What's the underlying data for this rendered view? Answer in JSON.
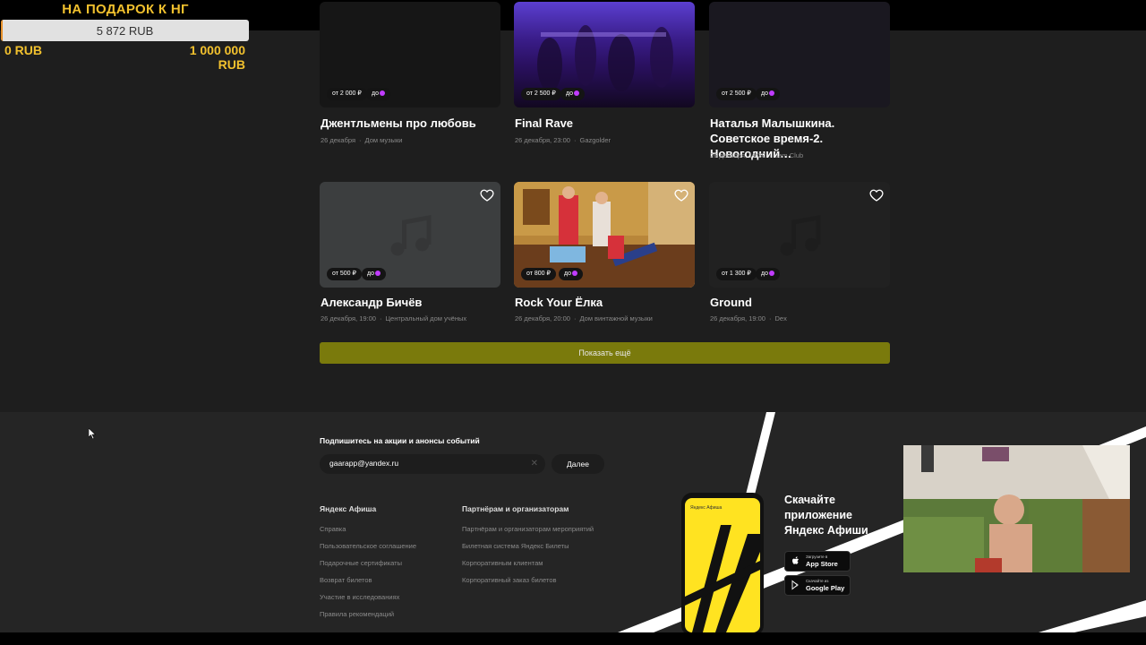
{
  "donation_goal": {
    "title": "НА ПОДАРОК К НГ",
    "current": "5 872 RUB",
    "min": "0 RUB",
    "max": "1 000 000 RUB",
    "progress_fraction": 0.005872,
    "colors": {
      "accent": "#f2c12e",
      "fill": "#e7912b",
      "track": "#e1e1e1"
    }
  },
  "events": [
    {
      "name": "Джентльмены про любовь",
      "date": "26 декабря",
      "venue": "Дом музыки",
      "price": "от 2 000 ₽",
      "until": "до",
      "image": "dark"
    },
    {
      "name": "Final Rave",
      "date": "26 декабря, 23:00",
      "venue": "Gazgolder",
      "price": "от 2 500 ₽",
      "until": "до",
      "image": "party"
    },
    {
      "name": "Наталья Малышкина. Советское время-2. Новогодний…",
      "date": "26 декабря, 19:30",
      "venue": "Jam Club",
      "price": "от 2 500 ₽",
      "until": "до",
      "image": "dark-purple"
    },
    {
      "name": "Александр Бичёв",
      "date": "26 декабря, 19:00",
      "venue": "Центральный дом учёных",
      "price": "от 500 ₽",
      "until": "до",
      "image": "music-placeholder"
    },
    {
      "name": "Rock Your Ёлка",
      "date": "26 декабря, 20:00",
      "venue": "Дом винтажной музыки",
      "price": "от 800 ₽",
      "until": "до",
      "image": "retro-photo"
    },
    {
      "name": "Ground",
      "date": "26 декабря, 19:00",
      "venue": "Dex",
      "price": "от 1 300 ₽",
      "until": "до",
      "image": "music-placeholder-dark"
    }
  ],
  "show_more_label": "Показать ещё",
  "footer": {
    "subscribe_title": "Подпишитесь на акции и анонсы событий",
    "email_value": "gaarapp@yandex.ru",
    "next_label": "Далее",
    "col1_title": "Яндекс Афиша",
    "col1_links": [
      "Справка",
      "Пользовательское соглашение",
      "Подарочные сертификаты",
      "Возврат билетов",
      "Участие в исследованиях",
      "Правила рекомендаций"
    ],
    "col2_title": "Партнёрам и организаторам",
    "col2_links": [
      "Партнёрам и организаторам мероприятий",
      "Билетная система Яндекс Билеты",
      "Корпоративным клиентам",
      "Корпоративный заказ билетов"
    ],
    "app_title": "Скачайте приложение Яндекс Афиши",
    "phone_label": "Яндекс Афиша",
    "app_store": {
      "small": "Загрузите в",
      "big": "App Store"
    },
    "google_play": {
      "small": "Скачайте из",
      "big": "Google Play"
    }
  },
  "icons": [
    "heart-icon",
    "apple-icon",
    "google-play-icon",
    "clear-icon",
    "music-note-icon",
    "cursor-icon"
  ]
}
